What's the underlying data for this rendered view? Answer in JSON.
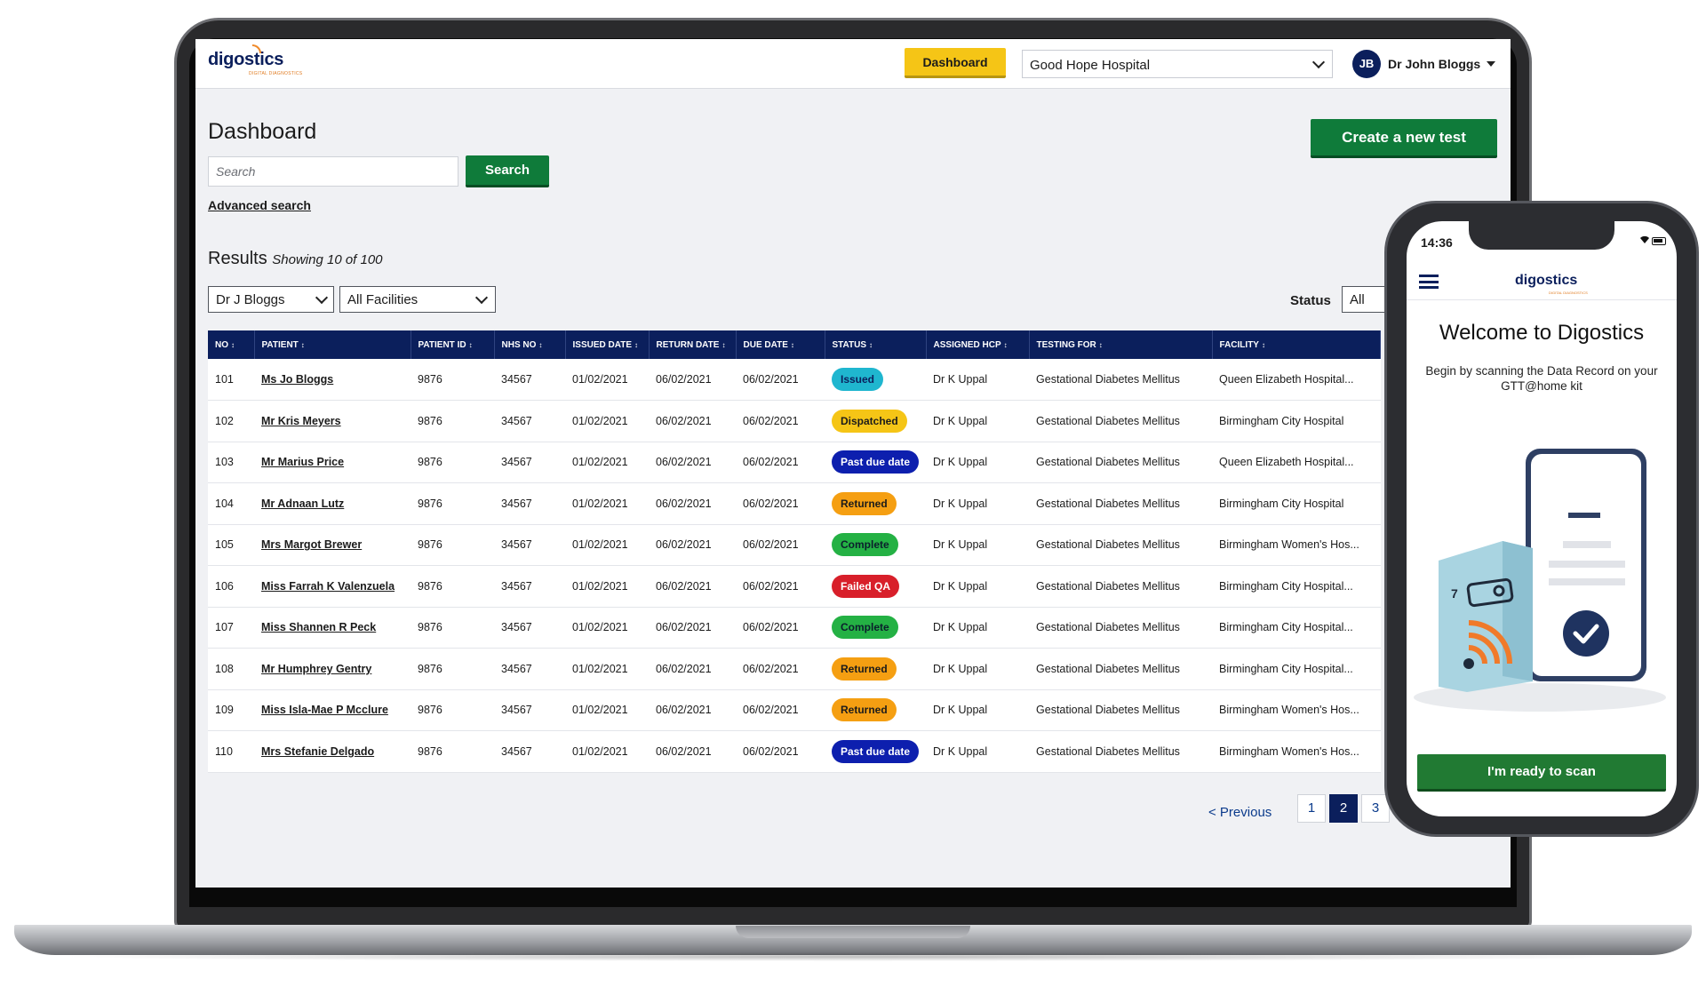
{
  "header": {
    "logo": "digostics",
    "logo_sub": "DIGITAL DIAGNOSTICS",
    "dashboard_button": "Dashboard",
    "hospital_selected": "Good Hope Hospital",
    "user_initials": "JB",
    "user_name": "Dr John Bloggs"
  },
  "main": {
    "title": "Dashboard",
    "search_placeholder": "Search",
    "search_button": "Search",
    "advanced_search": "Advanced search",
    "create_button": "Create a new test",
    "results_label": "Results",
    "results_sub": "Showing 10 of 100",
    "filter_hcp": "Dr J Bloggs",
    "filter_facility": "All Facilities",
    "status_label": "Status",
    "status_value": "All"
  },
  "table": {
    "columns": [
      "NO",
      "PATIENT",
      "PATIENT ID",
      "NHS NO",
      "ISSUED DATE",
      "RETURN DATE",
      "DUE DATE",
      "STATUS",
      "ASSIGNED HCP",
      "TESTING FOR",
      "FACILITY"
    ],
    "rows": [
      {
        "no": "101",
        "patient": "Ms Jo Bloggs",
        "pid": "9876",
        "nhs": "34567",
        "issued": "01/02/2021",
        "ret": "06/02/2021",
        "due": "06/02/2021",
        "status": "Issued",
        "hcp": "Dr K Uppal",
        "testing": "Gestational Diabetes Mellitus",
        "facility": "Queen Elizabeth Hospital..."
      },
      {
        "no": "102",
        "patient": "Mr Kris Meyers",
        "pid": "9876",
        "nhs": "34567",
        "issued": "01/02/2021",
        "ret": "06/02/2021",
        "due": "06/02/2021",
        "status": "Dispatched",
        "hcp": "Dr K Uppal",
        "testing": "Gestational Diabetes Mellitus",
        "facility": "Birmingham City Hospital"
      },
      {
        "no": "103",
        "patient": "Mr Marius Price",
        "pid": "9876",
        "nhs": "34567",
        "issued": "01/02/2021",
        "ret": "06/02/2021",
        "due": "06/02/2021",
        "status": "Past due date",
        "hcp": "Dr K Uppal",
        "testing": "Gestational Diabetes Mellitus",
        "facility": "Queen Elizabeth Hospital..."
      },
      {
        "no": "104",
        "patient": "Mr Adnaan Lutz",
        "pid": "9876",
        "nhs": "34567",
        "issued": "01/02/2021",
        "ret": "06/02/2021",
        "due": "06/02/2021",
        "status": "Returned",
        "hcp": "Dr K Uppal",
        "testing": "Gestational Diabetes Mellitus",
        "facility": "Birmingham City Hospital"
      },
      {
        "no": "105",
        "patient": "Mrs Margot Brewer",
        "pid": "9876",
        "nhs": "34567",
        "issued": "01/02/2021",
        "ret": "06/02/2021",
        "due": "06/02/2021",
        "status": "Complete",
        "hcp": "Dr K Uppal",
        "testing": "Gestational Diabetes Mellitus",
        "facility": "Birmingham Women's Hos..."
      },
      {
        "no": "106",
        "patient": "Miss Farrah K Valenzuela",
        "pid": "9876",
        "nhs": "34567",
        "issued": "01/02/2021",
        "ret": "06/02/2021",
        "due": "06/02/2021",
        "status": "Failed QA",
        "hcp": "Dr K Uppal",
        "testing": "Gestational Diabetes Mellitus",
        "facility": "Birmingham City Hospital..."
      },
      {
        "no": "107",
        "patient": "Miss Shannen R Peck",
        "pid": "9876",
        "nhs": "34567",
        "issued": "01/02/2021",
        "ret": "06/02/2021",
        "due": "06/02/2021",
        "status": "Complete",
        "hcp": "Dr K Uppal",
        "testing": "Gestational Diabetes Mellitus",
        "facility": "Birmingham City Hospital..."
      },
      {
        "no": "108",
        "patient": "Mr Humphrey Gentry",
        "pid": "9876",
        "nhs": "34567",
        "issued": "01/02/2021",
        "ret": "06/02/2021",
        "due": "06/02/2021",
        "status": "Returned",
        "hcp": "Dr K Uppal",
        "testing": "Gestational Diabetes Mellitus",
        "facility": "Birmingham City Hospital..."
      },
      {
        "no": "109",
        "patient": "Miss Isla-Mae P Mcclure",
        "pid": "9876",
        "nhs": "34567",
        "issued": "01/02/2021",
        "ret": "06/02/2021",
        "due": "06/02/2021",
        "status": "Returned",
        "hcp": "Dr K Uppal",
        "testing": "Gestational Diabetes Mellitus",
        "facility": "Birmingham Women's Hos..."
      },
      {
        "no": "110",
        "patient": "Mrs Stefanie Delgado",
        "pid": "9876",
        "nhs": "34567",
        "issued": "01/02/2021",
        "ret": "06/02/2021",
        "due": "06/02/2021",
        "status": "Past due date",
        "hcp": "Dr K Uppal",
        "testing": "Gestational Diabetes Mellitus",
        "facility": "Birmingham Women's Hos..."
      }
    ]
  },
  "status_colors": {
    "Issued": "#1fb6cf",
    "Dispatched": "#f5c516",
    "Past due date": "#0d1fae",
    "Returned": "#f59f12",
    "Complete": "#24b144",
    "Failed QA": "#d81f2a"
  },
  "pagination": {
    "previous": "< Previous",
    "pages": [
      "1",
      "2",
      "3"
    ],
    "current": "2"
  },
  "phone": {
    "time": "14:36",
    "logo": "digostics",
    "logo_sub": "DIGITAL DIAGNOSTICS",
    "welcome": "Welcome to Digostics",
    "subtitle": "Begin by scanning the Data Record on your GTT@home kit",
    "kit_number": "7",
    "scan_button": "I'm ready to scan"
  },
  "colors": {
    "navy": "#0b1f5c",
    "green": "#0f7b3a",
    "yellow": "#f5c516"
  }
}
